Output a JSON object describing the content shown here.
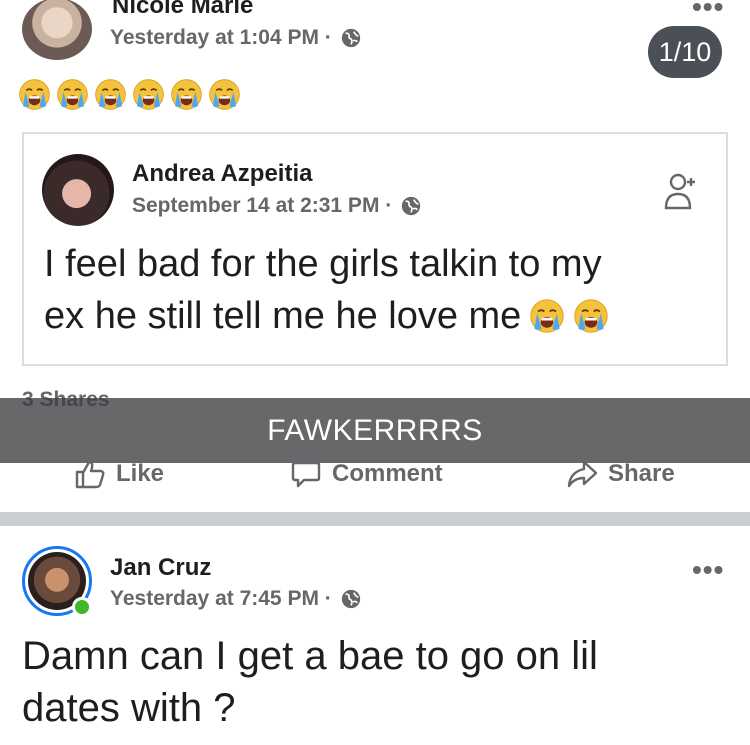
{
  "post1": {
    "author": "Nicole Marie",
    "timestamp": "Yesterday at 1:04 PM · ",
    "photo_counter": "1/10",
    "emoji_count": 6,
    "emoji": "loudly-crying-face"
  },
  "shared": {
    "author": "Andrea Azpeitia",
    "timestamp": "September 14 at 2:31 PM · ",
    "text_line1": "I feel bad for the girls talkin to my",
    "text_line2": "ex he still tell me he love me"
  },
  "stats": {
    "shares": "3 Shares"
  },
  "overlay_caption": "FAWKERRRRS",
  "actions": {
    "like": "Like",
    "comment": "Comment",
    "share": "Share"
  },
  "post2": {
    "author": "Jan Cruz",
    "timestamp": "Yesterday at 7:45 PM · ",
    "text_line1": "Damn can I get a bae to go on lil",
    "text_line2": "dates with ?"
  },
  "colors": {
    "fb_blue": "#1877f2",
    "secondary_text": "#65676b",
    "online_green": "#42b72a",
    "overlay": "#3c3e40"
  }
}
